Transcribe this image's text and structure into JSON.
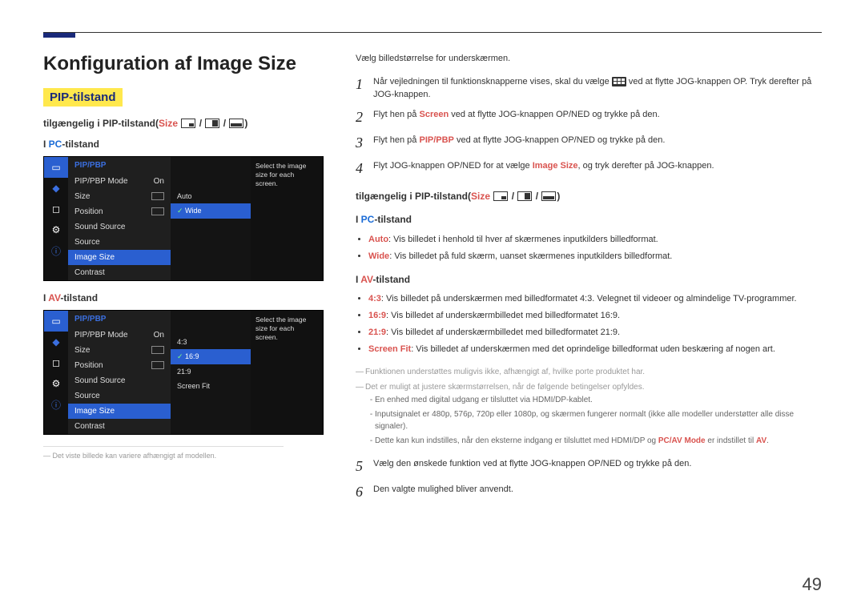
{
  "h1": "Konfiguration af Image Size",
  "pip_badge": "PIP-tilstand",
  "avail_prefix": "tilgængelig i PIP-tilstand(",
  "avail_size": "Size",
  "avail_suffix": ")",
  "pc_mode": {
    "label": "I ",
    "name": "PC",
    "suffix": "-tilstand"
  },
  "av_mode": {
    "label": "I ",
    "name": "AV",
    "suffix": "-tilstand"
  },
  "osd": {
    "title": "PIP/PBP",
    "tip": "Select the image size for each screen.",
    "items": [
      "PIP/PBP Mode",
      "Size",
      "Position",
      "Sound Source",
      "Source",
      "Image Size",
      "Contrast"
    ],
    "on": "On",
    "pc_opts": [
      "Auto",
      "Wide"
    ],
    "av_opts": [
      "4:3",
      "16:9",
      "21:9",
      "Screen Fit"
    ]
  },
  "right_intro": "Vælg billedstørrelse for underskærmen.",
  "steps": [
    {
      "n": "1",
      "before": "Når vejledningen til funktionsknapperne vises, skal du vælge ",
      "after": " ved at flytte JOG-knappen OP. Tryk derefter på JOG-knappen."
    },
    {
      "n": "2",
      "before": "Flyt hen på ",
      "hl": "Screen",
      "after": " ved at flytte JOG-knappen OP/NED og trykke på den."
    },
    {
      "n": "3",
      "before": "Flyt hen på ",
      "hl": "PIP/PBP",
      "after": " ved at flytte JOG-knappen OP/NED og trykke på den."
    },
    {
      "n": "4",
      "before": "Flyt JOG-knappen OP/NED for at vælge ",
      "hl": "Image Size",
      "after": ", og tryk derefter på JOG-knappen."
    }
  ],
  "pc_bullets": [
    {
      "hl": "Auto",
      "text": ": Vis billedet i henhold til hver af skærmenes inputkilders billedformat."
    },
    {
      "hl": "Wide",
      "text": ": Vis billedet på fuld skærm, uanset skærmenes inputkilders billedformat."
    }
  ],
  "av_bullets": [
    {
      "hl": "4:3",
      "text": ": Vis billedet på underskærmen med billedformatet 4:3. Velegnet til videoer og almindelige TV-programmer."
    },
    {
      "hl": "16:9",
      "text": ": Vis billedet af underskærmbilledet med billedformatet 16:9."
    },
    {
      "hl": "21:9",
      "text": ": Vis billedet af underskærmbilledet med billedformatet 21:9."
    },
    {
      "hl": "Screen Fit",
      "text": ": Vis billedet af underskærmen med det oprindelige billedformat uden beskæring af nogen art."
    }
  ],
  "notes": [
    "Funktionen understøttes muligvis ikke, afhængigt af, hvilke porte produktet har.",
    "Det er muligt at justere skærmstørrelsen, når de følgende betingelser opfyldes."
  ],
  "subnotes": [
    "En enhed med digital udgang er tilsluttet via HDMI/DP-kablet.",
    "Inputsignalet er 480p, 576p, 720p eller 1080p, og skærmen fungerer normalt (ikke alle modeller understøtter alle disse signaler)."
  ],
  "subnote3_before": "Dette kan kun indstilles, når den eksterne indgang er tilsluttet med HDMI/DP og ",
  "subnote3_hl1": "PC/AV Mode",
  "subnote3_mid": " er indstillet til ",
  "subnote3_hl2": "AV",
  "subnote3_after": ".",
  "step5": {
    "n": "5",
    "text": "Vælg den ønskede funktion ved at flytte JOG-knappen OP/NED og trykke på den."
  },
  "step6": {
    "n": "6",
    "text": "Den valgte mulighed bliver anvendt."
  },
  "footnote": "Det viste billede kan variere afhængigt af modellen.",
  "page_num": "49"
}
